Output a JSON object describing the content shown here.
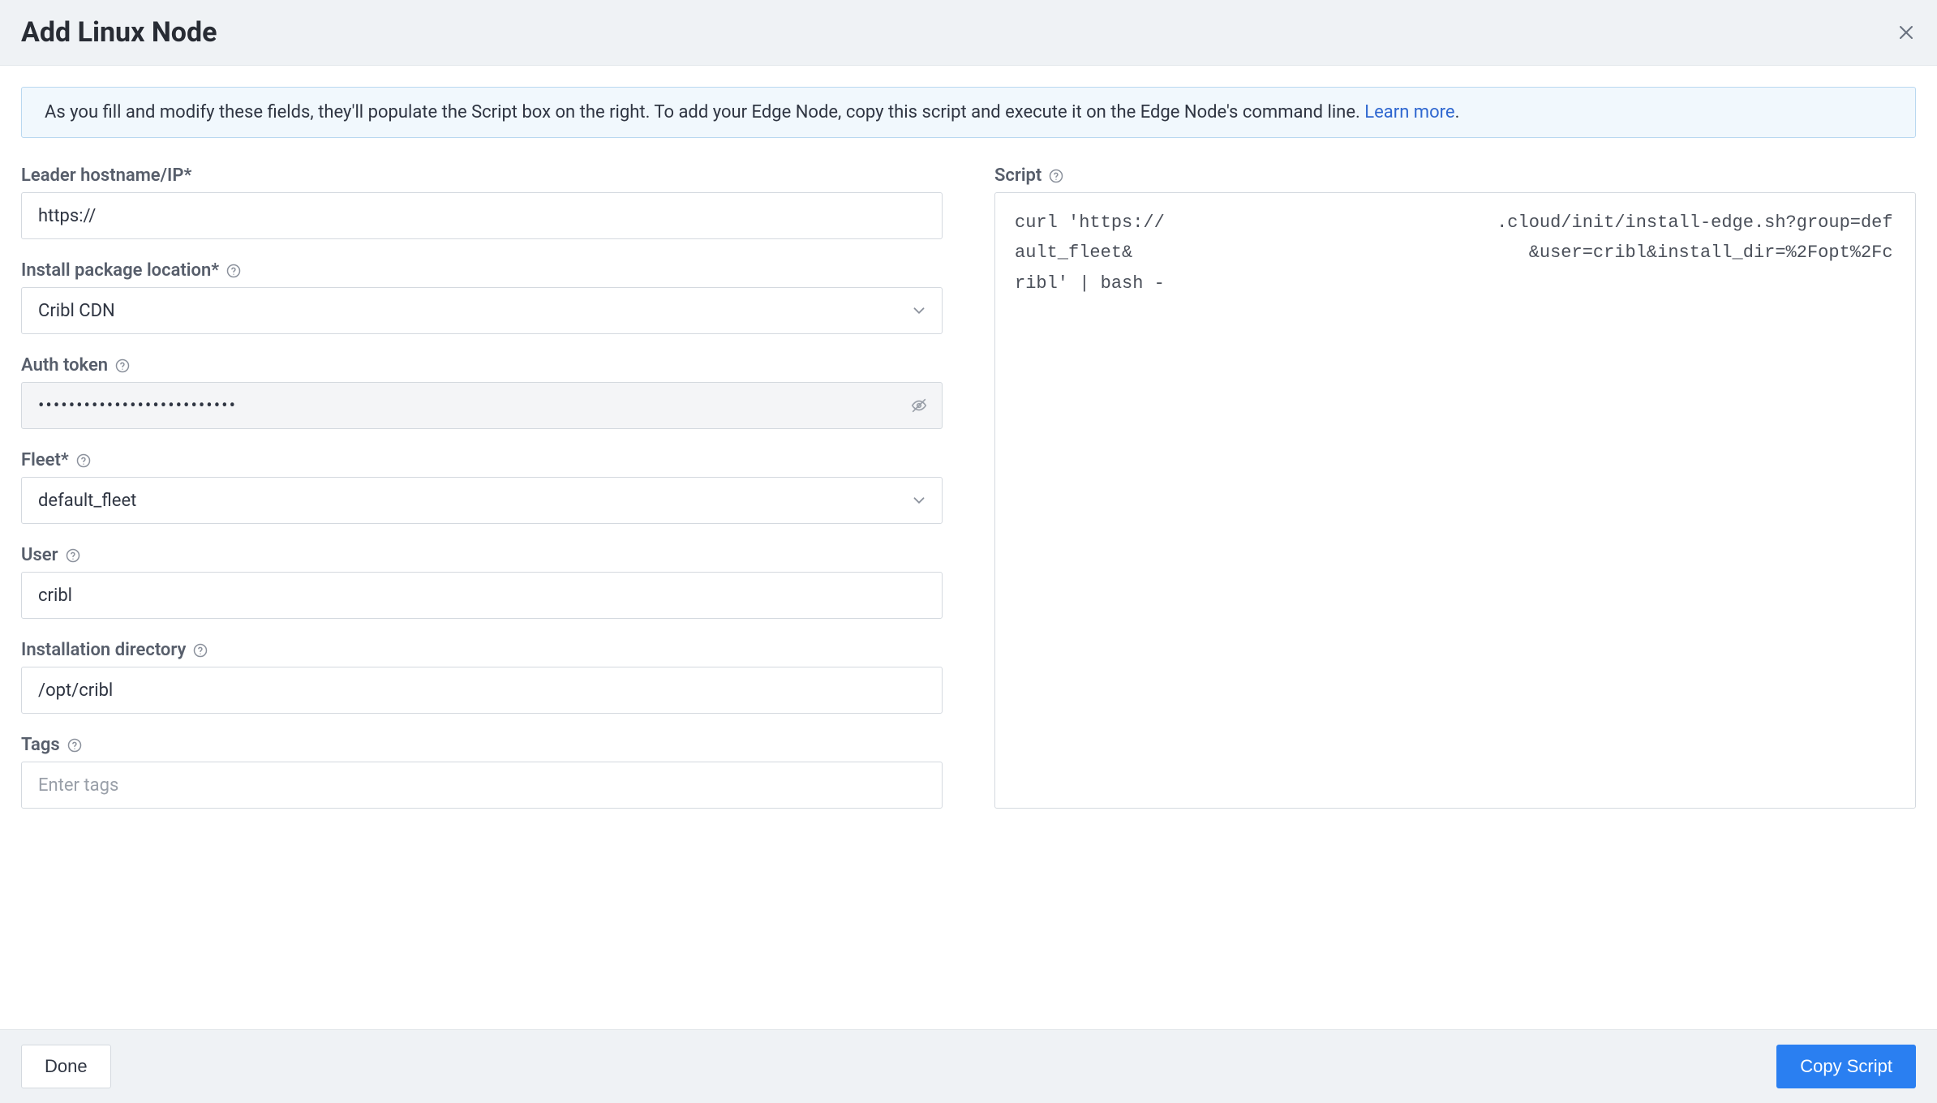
{
  "header": {
    "title": "Add Linux Node"
  },
  "banner": {
    "text": "As you fill and modify these fields, they'll populate the Script box on the right. To add your Edge Node, copy this script and execute it on the Edge Node's command line. ",
    "link_text": "Learn more",
    "period": "."
  },
  "form": {
    "leader": {
      "label": "Leader hostname/IP*",
      "value": "https://"
    },
    "install_pkg": {
      "label": "Install package location*",
      "value": "Cribl CDN"
    },
    "auth_token": {
      "label": "Auth token",
      "value": "••••••••••••••••••••••••••"
    },
    "fleet": {
      "label": "Fleet*",
      "value": "default_fleet"
    },
    "user": {
      "label": "User",
      "value": "cribl"
    },
    "install_dir": {
      "label": "Installation directory",
      "value": "/opt/cribl"
    },
    "tags": {
      "label": "Tags",
      "placeholder": "Enter tags"
    }
  },
  "script": {
    "label": "Script",
    "content": "curl 'https://                               .cloud/init/install-edge.sh?group=default_fleet&                                     &user=cribl&install_dir=%2Fopt%2Fcribl' | bash -"
  },
  "footer": {
    "done": "Done",
    "copy": "Copy Script"
  }
}
